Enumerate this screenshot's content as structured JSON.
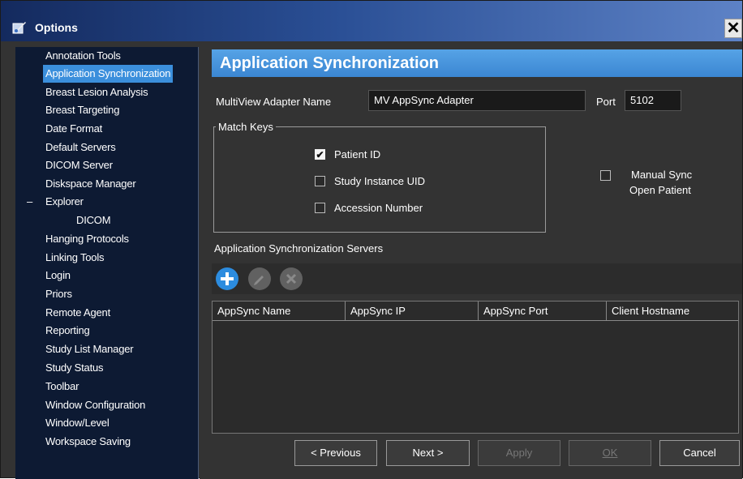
{
  "window": {
    "title": "Options",
    "close_glyph": "✕"
  },
  "sidebar": {
    "items": [
      {
        "label": "Annotation Tools"
      },
      {
        "label": "Application Synchronization",
        "selected": true
      },
      {
        "label": "Breast Lesion Analysis"
      },
      {
        "label": "Breast Targeting"
      },
      {
        "label": "Date Format"
      },
      {
        "label": "Default Servers"
      },
      {
        "label": "DICOM Server"
      },
      {
        "label": "Diskspace Manager"
      },
      {
        "label": "Explorer",
        "expanded": true
      },
      {
        "label": "DICOM",
        "child": true
      },
      {
        "label": "Hanging Protocols"
      },
      {
        "label": "Linking Tools"
      },
      {
        "label": "Login"
      },
      {
        "label": "Priors"
      },
      {
        "label": "Remote Agent"
      },
      {
        "label": "Reporting"
      },
      {
        "label": "Study List Manager"
      },
      {
        "label": "Study Status"
      },
      {
        "label": "Toolbar"
      },
      {
        "label": "Window Configuration"
      },
      {
        "label": "Window/Level"
      },
      {
        "label": "Workspace Saving"
      }
    ],
    "collapse_glyph": "–"
  },
  "main": {
    "header": "Application Synchronization",
    "adapter_label": "MultiView Adapter Name",
    "adapter_value": "MV AppSync Adapter",
    "port_label": "Port",
    "port_value": "5102",
    "match_keys": {
      "title": "Match Keys",
      "items": [
        {
          "label": "Patient ID",
          "checked": true
        },
        {
          "label": "Study Instance UID",
          "checked": false
        },
        {
          "label": "Accession Number",
          "checked": false
        }
      ]
    },
    "manual_sync": {
      "label_line1": "Manual Sync",
      "label_line2": "Open Patient",
      "checked": false
    },
    "servers_label": "Application Synchronization Servers",
    "toolbar": [
      "add-icon",
      "edit-icon",
      "remove-icon"
    ],
    "table": {
      "columns": [
        "AppSync Name",
        "AppSync IP",
        "AppSync Port",
        "Client Hostname"
      ]
    },
    "buttons": {
      "previous": "< Previous",
      "next": "Next >",
      "apply": "Apply",
      "ok": "OK",
      "cancel": "Cancel"
    }
  },
  "colors": {
    "selection": "#3b8fdc",
    "header_blue": "#3b86d2",
    "background": "#333333",
    "sidebar_bg": "#0d1a33"
  }
}
